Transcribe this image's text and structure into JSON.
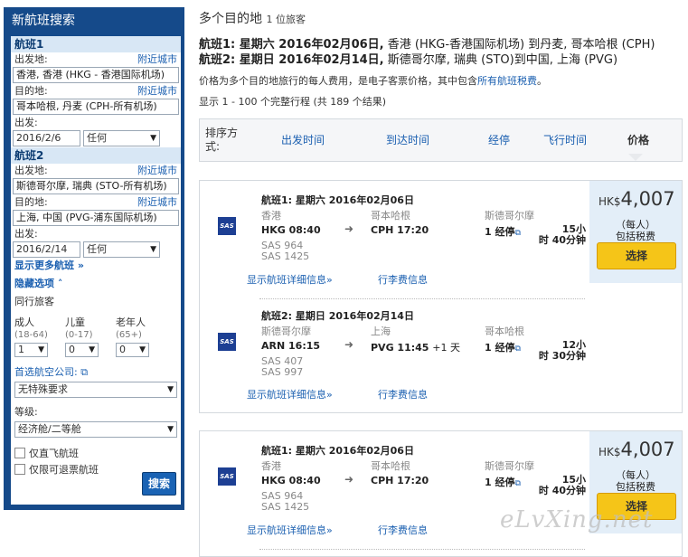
{
  "sidebar": {
    "title": "新航班搜索",
    "segment1": {
      "heading": "航班1",
      "from_label": "出发地:",
      "from_link": "附近城市",
      "from_value": "香港, 香港 (HKG - 香港国际机场)",
      "to_label": "目的地:",
      "to_link": "附近城市",
      "to_value": "哥本哈根, 丹麦 (CPH-所有机场)",
      "date_label": "出发:",
      "date_value": "2016/2/6",
      "time_value": "任何"
    },
    "segment2": {
      "heading": "航班2",
      "from_label": "出发地:",
      "from_link": "附近城市",
      "from_value": "斯德哥尔摩, 瑞典 (STO-所有机场)",
      "to_label": "目的地:",
      "to_link": "附近城市",
      "to_value": "上海, 中国 (PVG-浦东国际机场)",
      "date_label": "出发:",
      "date_value": "2016/2/14",
      "time_value": "任何"
    },
    "more_flights": "显示更多航班",
    "hide_options": "隐藏选项",
    "passengers_label": "同行旅客",
    "adult_label": "成人",
    "adult_range": "(18-64)",
    "adult_value": "1",
    "child_label": "儿童",
    "child_range": "(0-17)",
    "child_value": "0",
    "senior_label": "老年人",
    "senior_range": "(65+)",
    "senior_value": "0",
    "airline_label": "首选航空公司:",
    "airline_value": "无特殊要求",
    "class_label": "等级:",
    "class_value": "经济舱/二等舱",
    "nonstop_label": "仅直飞航班",
    "refundable_label": "仅限可退票航班",
    "search_button": "搜索"
  },
  "header": {
    "title": "多个目的地",
    "travelers": "1 位旅客",
    "seg1_prefix": "航班1: 星期六 2016年02月06日,",
    "seg1_text": " 香港 (HKG-香港国际机场) 到丹麦, 哥本哈根 (CPH)",
    "seg2_prefix": "航班2: 星期日 2016年02月14日,",
    "seg2_text": " 斯德哥尔摩, 瑞典 (STO)到中国, 上海 (PVG)",
    "note_text": "价格为多个目的地旅行的每人费用，是电子客票价格，其中包含",
    "note_link": "所有航班税费",
    "note_end": "。",
    "count_text": "显示 1 - 100 个完整行程 (共 189 个结果)"
  },
  "sortbar": {
    "label": "排序方式:",
    "depart": "出发时间",
    "arrive": "到达时间",
    "stops": "经停",
    "duration": "飞行时间",
    "price": "价格"
  },
  "results": [
    {
      "price_currency": "HK$",
      "price_amount": "4,007",
      "per_person": "（每人）",
      "tax_note": "包括税费",
      "select_label": "选择",
      "legs": [
        {
          "title": "航班1:  星期六 2016年02月06日",
          "from_city": "香港",
          "to_city": "哥本哈根",
          "via_city": "斯德哥尔摩",
          "depart": "HKG 08:40",
          "arrive": "CPH 17:20",
          "arrive_extra": "",
          "flight_a": "SAS 964",
          "flight_b": "SAS 1425",
          "stops": "1 经停",
          "dur_a": "15小",
          "dur_b": "时 40分钟",
          "details_link": "显示航班详细信息",
          "bag_link": "行李费信息",
          "airline_logo": "SAS"
        },
        {
          "title": "航班2:  星期日 2016年02月14日",
          "from_city": "斯德哥尔摩",
          "to_city": "上海",
          "via_city": "哥本哈根",
          "depart": "ARN 16:15",
          "arrive": "PVG 11:45",
          "arrive_extra": "+1 天",
          "flight_a": "SAS 407",
          "flight_b": "SAS 997",
          "stops": "1 经停",
          "dur_a": "12小",
          "dur_b": "时 30分钟",
          "details_link": "显示航班详细信息",
          "bag_link": "行李费信息",
          "airline_logo": "SAS"
        }
      ]
    },
    {
      "price_currency": "HK$",
      "price_amount": "4,007",
      "per_person": "（每人）",
      "tax_note": "包括税费",
      "select_label": "选择",
      "legs": [
        {
          "title": "航班1:  星期六 2016年02月06日",
          "from_city": "香港",
          "to_city": "哥本哈根",
          "via_city": "斯德哥尔摩",
          "depart": "HKG 08:40",
          "arrive": "CPH 17:20",
          "arrive_extra": "",
          "flight_a": "SAS 964",
          "flight_b": "SAS 1425",
          "stops": "1 经停",
          "dur_a": "15小",
          "dur_b": "时 40分钟",
          "details_link": "显示航班详细信息",
          "bag_link": "行李费信息",
          "airline_logo": "SAS"
        }
      ]
    }
  ],
  "watermark": "eLvXing.net",
  "colors": {
    "sidebar_bg": "#154a8a",
    "link": "#1a5fb0",
    "select_button": "#f5c518",
    "price_box": "#e3eef8"
  }
}
